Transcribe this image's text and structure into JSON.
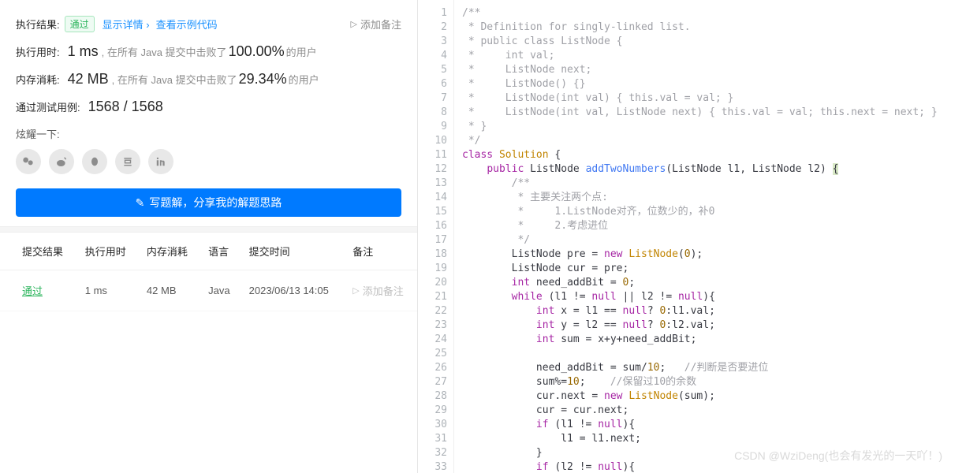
{
  "result": {
    "labels": {
      "exec_result": "执行结果:",
      "show_detail": "显示详情 ›",
      "view_sample": "查看示例代码",
      "add_note": "添加备注",
      "exec_time": "执行用时:",
      "memory": "内存消耗:",
      "passed_cases": "通过测试用例:",
      "share_title": "炫耀一下:",
      "write_solution": "写题解，分享我的解题思路"
    },
    "status": "通过",
    "time_value": "1 ms",
    "time_text_pre": ", 在所有 Java 提交中击败了",
    "time_pct": "100.00%",
    "time_text_post": "的用户",
    "mem_value": "42 MB",
    "mem_text_pre": ", 在所有 Java 提交中击败了",
    "mem_pct": "29.34%",
    "mem_text_post": "的用户",
    "cases": "1568 / 1568"
  },
  "table": {
    "headers": {
      "result": "提交结果",
      "time": "执行用时",
      "memory": "内存消耗",
      "lang": "语言",
      "submitted": "提交时间",
      "note": "备注"
    },
    "rows": [
      {
        "result": "通过",
        "time": "1 ms",
        "memory": "42 MB",
        "lang": "Java",
        "submitted": "2023/06/13 14:05",
        "note": "添加备注"
      }
    ]
  },
  "code_lines": [
    {
      "n": 1,
      "html": "<span class='c-comment'>/**</span>"
    },
    {
      "n": 2,
      "html": "<span class='c-comment'> * Definition for singly-linked list.</span>"
    },
    {
      "n": 3,
      "html": "<span class='c-comment'> * public class ListNode {</span>"
    },
    {
      "n": 4,
      "html": "<span class='c-comment'> *     int val;</span>"
    },
    {
      "n": 5,
      "html": "<span class='c-comment'> *     ListNode next;</span>"
    },
    {
      "n": 6,
      "html": "<span class='c-comment'> *     ListNode() {}</span>"
    },
    {
      "n": 7,
      "html": "<span class='c-comment'> *     ListNode(int val) { this.val = val; }</span>"
    },
    {
      "n": 8,
      "html": "<span class='c-comment'> *     ListNode(int val, ListNode next) { this.val = val; this.next = next; }</span>"
    },
    {
      "n": 9,
      "html": "<span class='c-comment'> * }</span>"
    },
    {
      "n": 10,
      "html": "<span class='c-comment'> */</span>"
    },
    {
      "n": 11,
      "html": "<span class='c-kw'>class</span> <span class='c-cls'>Solution</span> {"
    },
    {
      "n": 12,
      "html": "    <span class='c-kw'>public</span> ListNode <span class='c-fn'>addTwoNumbers</span>(ListNode l1, ListNode l2) <span class='c-brace-hl'>{</span>"
    },
    {
      "n": 13,
      "html": "        <span class='c-comment'>/**</span>"
    },
    {
      "n": 14,
      "html": "        <span class='c-comment'> * 主要关注两个点:</span>"
    },
    {
      "n": 15,
      "html": "        <span class='c-comment'> *     1.ListNode对齐，位数少的，补0</span>"
    },
    {
      "n": 16,
      "html": "        <span class='c-comment'> *     2.考虑进位</span>"
    },
    {
      "n": 17,
      "html": "        <span class='c-comment'> */</span>"
    },
    {
      "n": 18,
      "html": "        ListNode pre = <span class='c-kw'>new</span> <span class='c-cls'>ListNode</span>(<span class='c-num'>0</span>);"
    },
    {
      "n": 19,
      "html": "        ListNode cur = pre;"
    },
    {
      "n": 20,
      "html": "        <span class='c-kw'>int</span> need_addBit = <span class='c-num'>0</span>;"
    },
    {
      "n": 21,
      "html": "        <span class='c-kw'>while</span> (l1 != <span class='c-kw'>null</span> || l2 != <span class='c-kw'>null</span>){"
    },
    {
      "n": 22,
      "html": "            <span class='c-kw'>int</span> x = l1 == <span class='c-kw'>null</span>? <span class='c-num'>0</span>:l1.val;"
    },
    {
      "n": 23,
      "html": "            <span class='c-kw'>int</span> y = l2 == <span class='c-kw'>null</span>? <span class='c-num'>0</span>:l2.val;"
    },
    {
      "n": 24,
      "html": "            <span class='c-kw'>int</span> sum = x+y+need_addBit;"
    },
    {
      "n": 25,
      "html": ""
    },
    {
      "n": 26,
      "html": "            need_addBit = sum/<span class='c-num'>10</span>;   <span class='c-comment'>//判断是否要进位</span>"
    },
    {
      "n": 27,
      "html": "            sum%=<span class='c-num'>10</span>;    <span class='c-comment'>//保留过10的余数</span>"
    },
    {
      "n": 28,
      "html": "            cur.next = <span class='c-kw'>new</span> <span class='c-cls'>ListNode</span>(sum);"
    },
    {
      "n": 29,
      "html": "            cur = cur.next;"
    },
    {
      "n": 30,
      "html": "            <span class='c-kw'>if</span> (l1 != <span class='c-kw'>null</span>){"
    },
    {
      "n": 31,
      "html": "                l1 = l1.next;"
    },
    {
      "n": 32,
      "html": "            }"
    },
    {
      "n": 33,
      "html": "            <span class='c-kw'>if</span> (l2 != <span class='c-kw'>null</span>){"
    }
  ],
  "watermark": "CSDN @WziDeng(也会有发光的一天吖！)"
}
